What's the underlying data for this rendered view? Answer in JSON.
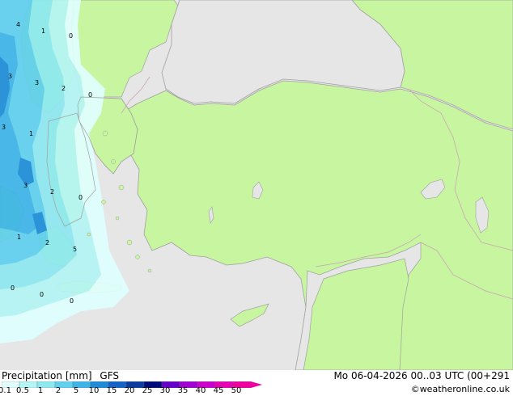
{
  "legend": {
    "title": "Precipitation [mm]",
    "model": "GFS",
    "scale_labels": [
      "0.1",
      "0.5",
      "1",
      "2",
      "5",
      "10",
      "15",
      "20",
      "25",
      "30",
      "35",
      "40",
      "45",
      "50"
    ],
    "scale_colors": [
      "#e0ffff",
      "#b4f5f5",
      "#8ee8f0",
      "#5fd0ee",
      "#3cb4e8",
      "#1e8cd8",
      "#1464c8",
      "#0a3ca0",
      "#000a78",
      "#6400c8",
      "#a000d2",
      "#cc00cc",
      "#e600b4",
      "#f000a0"
    ]
  },
  "timestamp": "Mo 06-04-2026 00..03 UTC (00+291",
  "credit": "©weatheronline.co.uk",
  "colors": {
    "sea": "#e6e6e6",
    "land": "#c8f5a0",
    "coast": "#a0a0a0",
    "border": "#c8a0b4"
  },
  "map_labels": [
    "4",
    "1",
    "0",
    "3",
    "3",
    "2",
    "0",
    "3",
    "1",
    "3",
    "2",
    "0",
    "1",
    "2",
    "5",
    "0",
    "0",
    "0"
  ]
}
